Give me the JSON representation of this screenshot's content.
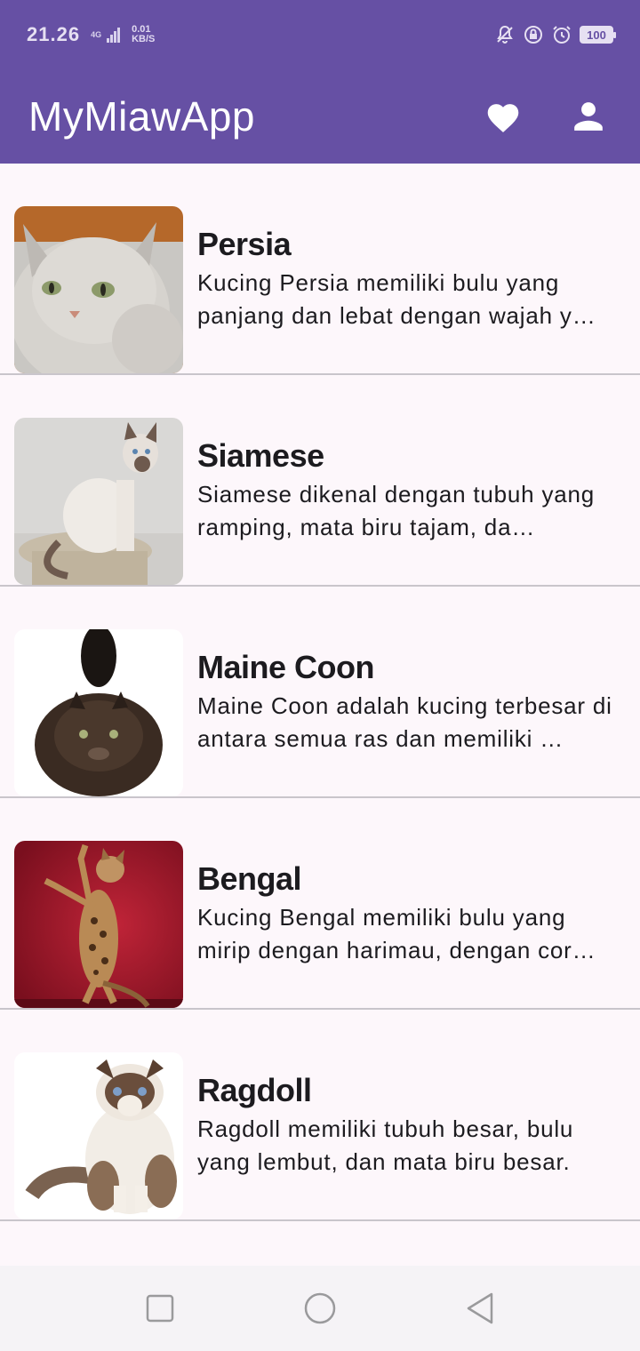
{
  "status_bar": {
    "time": "21.26",
    "network": "4G",
    "speed_value": "0.01",
    "speed_unit": "KB/S",
    "battery": "100"
  },
  "app_bar": {
    "title": "MyMiawApp",
    "favorite_icon": "heart-icon",
    "profile_icon": "person-icon"
  },
  "cats": [
    {
      "name": "Persia",
      "description": "Kucing Persia memiliki bulu yang panjang dan lebat dengan wajah y…"
    },
    {
      "name": "Siamese",
      "description": "Siamese dikenal dengan tubuh yang ramping, mata biru tajam, da…"
    },
    {
      "name": "Maine Coon",
      "description": "Maine Coon adalah kucing terbesar di antara semua ras dan memiliki …"
    },
    {
      "name": "Bengal",
      "description": "Kucing Bengal memiliki bulu yang mirip dengan harimau, dengan cor…"
    },
    {
      "name": "Ragdoll",
      "description": "Ragdoll memiliki tubuh besar, bulu yang lembut, dan mata biru besar."
    }
  ],
  "nav_bar": {
    "recents_icon": "square-icon",
    "home_icon": "circle-icon",
    "back_icon": "triangle-back-icon"
  },
  "colors": {
    "primary": "#6650a4",
    "background": "#fdf7fb",
    "divider": "#c9c5cb",
    "text": "#1c1b1f"
  }
}
